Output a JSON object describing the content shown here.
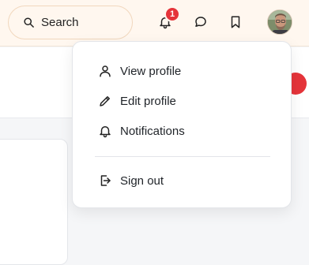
{
  "search": {
    "label": "Search",
    "icon": "search-icon"
  },
  "notifications": {
    "count": "1",
    "icon": "bell-icon"
  },
  "header_icons": [
    "bell-icon",
    "chat-bubble-icon",
    "bookmark-icon"
  ],
  "colors": {
    "badge": "#e5343a",
    "topbar": "#fff7ef"
  },
  "menu": {
    "items": [
      {
        "label": "View profile",
        "icon": "user-icon"
      },
      {
        "label": "Edit profile",
        "icon": "pencil-icon"
      },
      {
        "label": "Notifications",
        "icon": "bell-icon"
      },
      {
        "label": "Sign out",
        "icon": "sign-out-icon"
      }
    ]
  }
}
